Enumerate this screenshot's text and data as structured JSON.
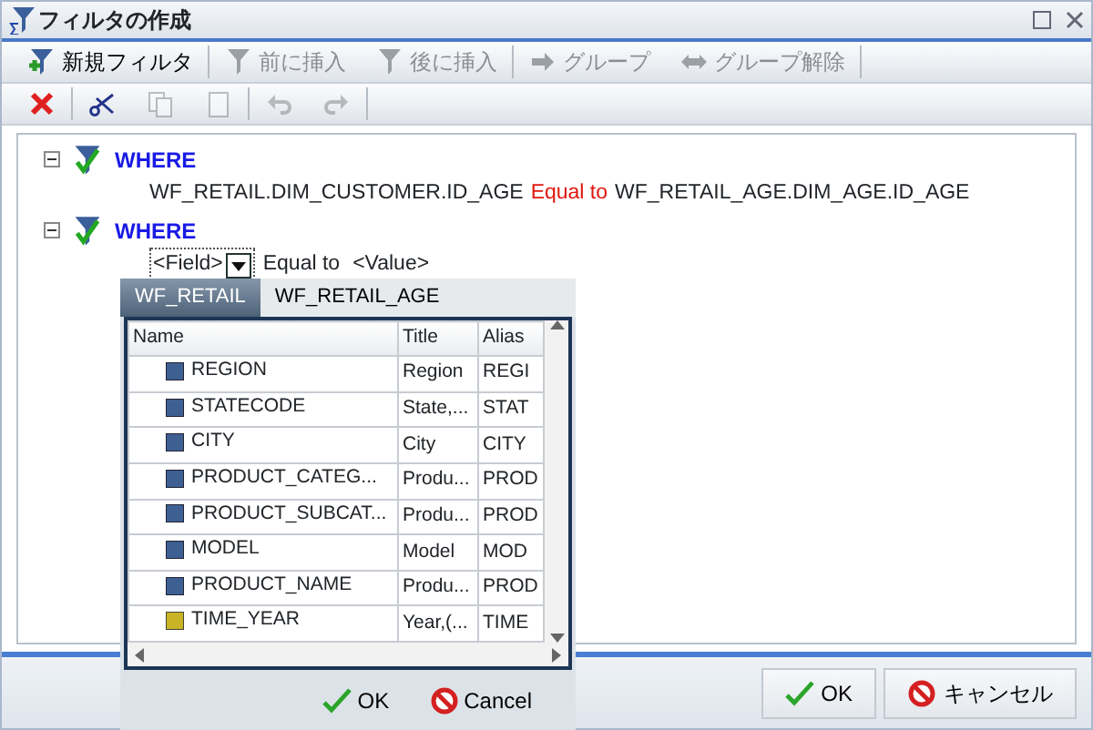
{
  "window": {
    "title": "フィルタの作成"
  },
  "toolbar": [
    {
      "kind": "new",
      "label": "新規フィルタ",
      "disabled": false
    },
    {
      "kind": "insert-before",
      "label": "前に挿入",
      "disabled": true
    },
    {
      "kind": "insert-after",
      "label": "後に挿入",
      "disabled": true
    },
    {
      "kind": "group",
      "label": "グループ",
      "disabled": true
    },
    {
      "kind": "ungroup",
      "label": "グループ解除",
      "disabled": true
    }
  ],
  "edit_toolbar": [
    {
      "kind": "delete",
      "disabled": false
    },
    {
      "kind": "cut",
      "disabled": false
    },
    {
      "kind": "copy",
      "disabled": true
    },
    {
      "kind": "paste",
      "disabled": true
    },
    {
      "kind": "undo",
      "disabled": true
    },
    {
      "kind": "redo",
      "disabled": true
    }
  ],
  "filters": [
    {
      "keyword": "WHERE",
      "expanded": true,
      "editing": false,
      "condition": {
        "left": "WF_RETAIL.DIM_CUSTOMER.ID_AGE",
        "operator": "Equal to",
        "right": "WF_RETAIL_AGE.DIM_AGE.ID_AGE"
      }
    },
    {
      "keyword": "WHERE",
      "expanded": true,
      "editing": true,
      "condition": {
        "left": "<Field>",
        "operator": "Equal to",
        "right": "<Value>"
      }
    }
  ],
  "field_picker": {
    "tabs": [
      {
        "label": "WF_RETAIL",
        "selected": true
      },
      {
        "label": "WF_RETAIL_AGE",
        "selected": false
      }
    ],
    "columns": [
      "Name",
      "Title",
      "Alias"
    ],
    "rows": [
      {
        "kind": "dimension",
        "name": "REGION",
        "title": "Region",
        "alias": "REGI"
      },
      {
        "kind": "dimension",
        "name": "STATECODE",
        "title": "State,...",
        "alias": "STAT"
      },
      {
        "kind": "dimension",
        "name": "CITY",
        "title": "City",
        "alias": "CITY"
      },
      {
        "kind": "dimension",
        "name": "PRODUCT_CATEG...",
        "title": "Produ...",
        "alias": "PROD"
      },
      {
        "kind": "dimension",
        "name": "PRODUCT_SUBCAT...",
        "title": "Produ...",
        "alias": "PROD"
      },
      {
        "kind": "dimension",
        "name": "MODEL",
        "title": "Model",
        "alias": "MOD"
      },
      {
        "kind": "dimension",
        "name": "PRODUCT_NAME",
        "title": "Produ...",
        "alias": "PROD"
      },
      {
        "kind": "date",
        "name": "TIME_YEAR",
        "title": "Year,(...",
        "alias": "TIME"
      }
    ],
    "buttons": [
      {
        "kind": "ok",
        "label": "OK"
      },
      {
        "kind": "cancel",
        "label": "Cancel"
      }
    ]
  },
  "footer_buttons": [
    {
      "kind": "ok",
      "label": "OK"
    },
    {
      "kind": "cancel",
      "label": "キャンセル"
    }
  ]
}
